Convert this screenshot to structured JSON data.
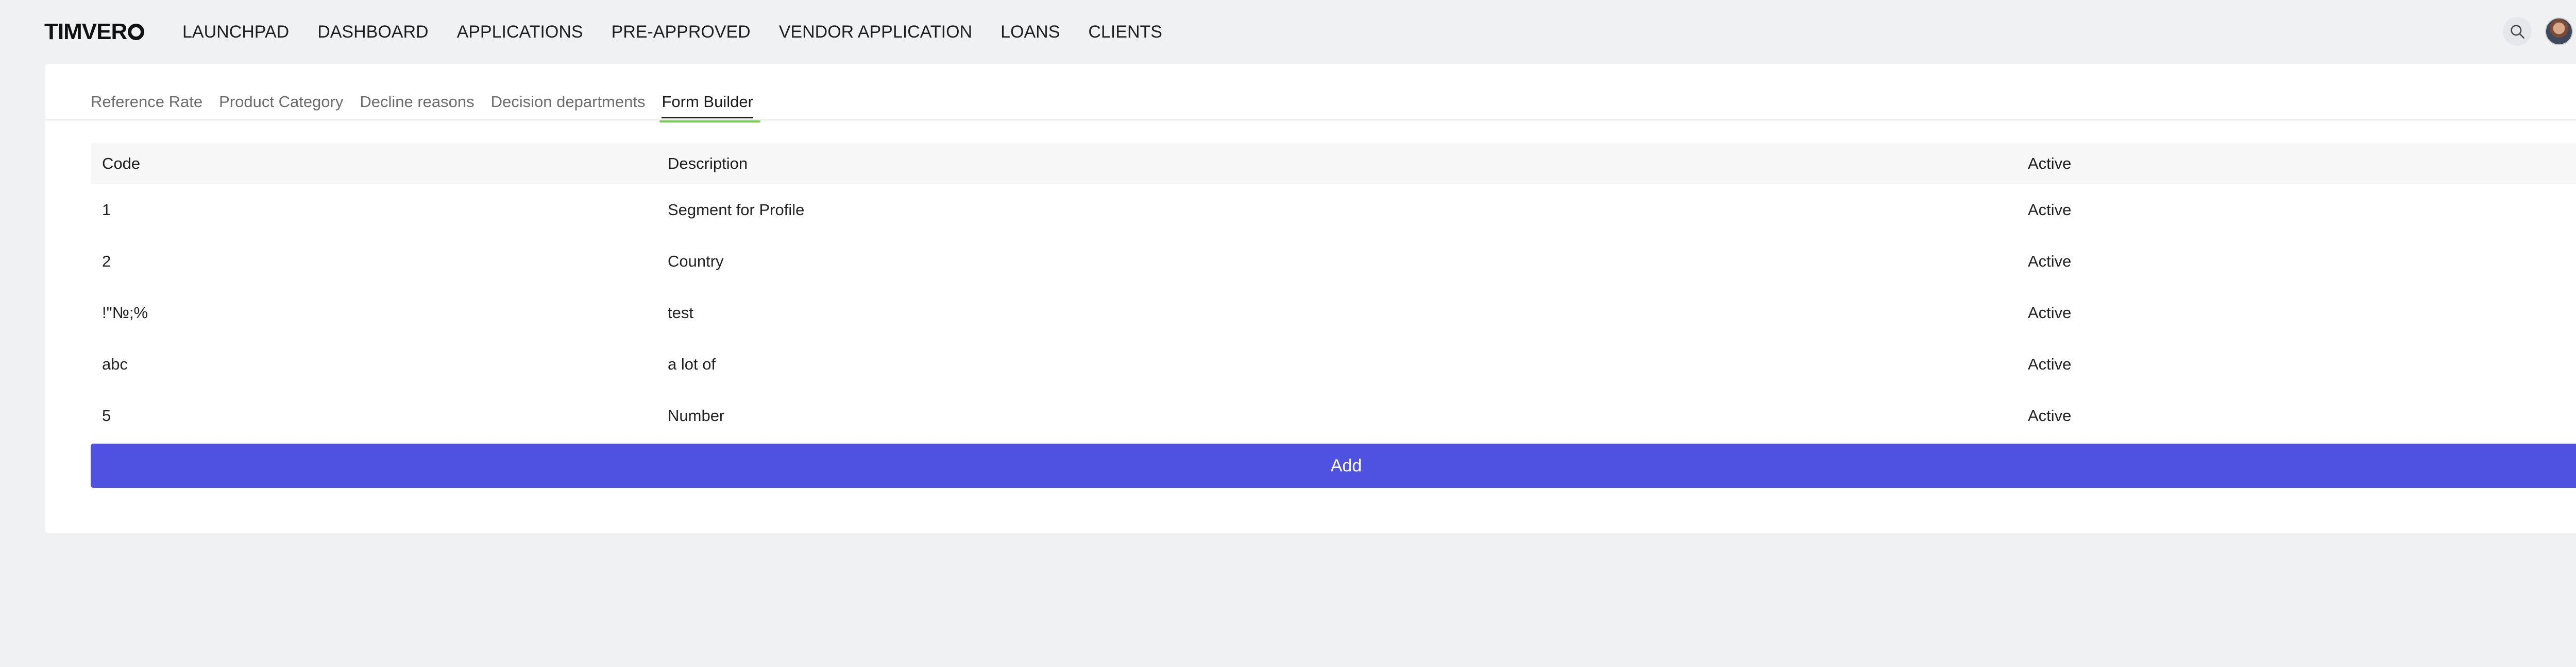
{
  "app": {
    "logo_prefix": "TIMVER",
    "logo_full": "TIMVERO"
  },
  "nav": {
    "items": [
      "LAUNCHPAD",
      "DASHBOARD",
      "APPLICATIONS",
      "PRE-APPROVED",
      "VENDOR APPLICATION",
      "LOANS",
      "CLIENTS"
    ]
  },
  "header": {
    "search_icon": "search-icon",
    "avatar_icon": "avatar",
    "chevron_icon": "chevron-down-icon"
  },
  "tabs": {
    "items": [
      "Reference Rate",
      "Product Category",
      "Decline reasons",
      "Decision departments",
      "Form Builder"
    ],
    "active_index": 4
  },
  "table": {
    "columns": [
      "Code",
      "Description",
      "Active"
    ],
    "rows": [
      {
        "code": "1",
        "description": "Segment for Profile",
        "active": "Active"
      },
      {
        "code": "2",
        "description": "Country",
        "active": "Active"
      },
      {
        "code": "!\"№;%",
        "description": "test",
        "active": "Active"
      },
      {
        "code": "abc",
        "description": "a lot of",
        "active": "Active"
      },
      {
        "code": "5",
        "description": "Number",
        "active": "Active"
      }
    ]
  },
  "actions": {
    "add_label": "Add"
  },
  "colors": {
    "accent": "#4f52e0",
    "tab_active_underline": "#72d04a",
    "background": "#f0f1f3"
  }
}
